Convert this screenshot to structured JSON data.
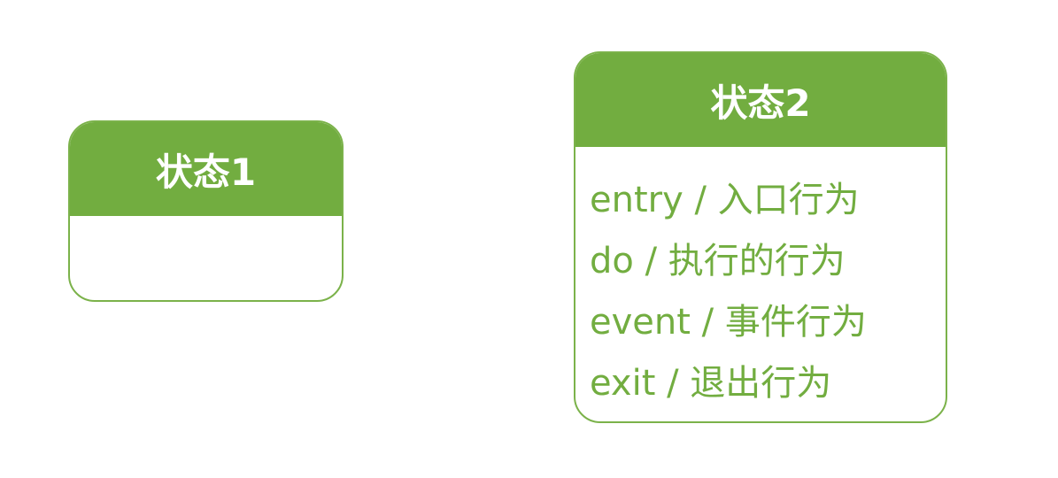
{
  "states": [
    {
      "title": "状态1",
      "actions": []
    },
    {
      "title": "状态2",
      "actions": [
        "entry / 入口行为",
        "do / 执行的行为",
        "event / 事件行为",
        "exit / 退出行为"
      ]
    }
  ],
  "colors": {
    "header_fill": "#72ad40",
    "border": "#7bb24a",
    "action_text": "#72ad40",
    "header_text": "#ffffff"
  }
}
